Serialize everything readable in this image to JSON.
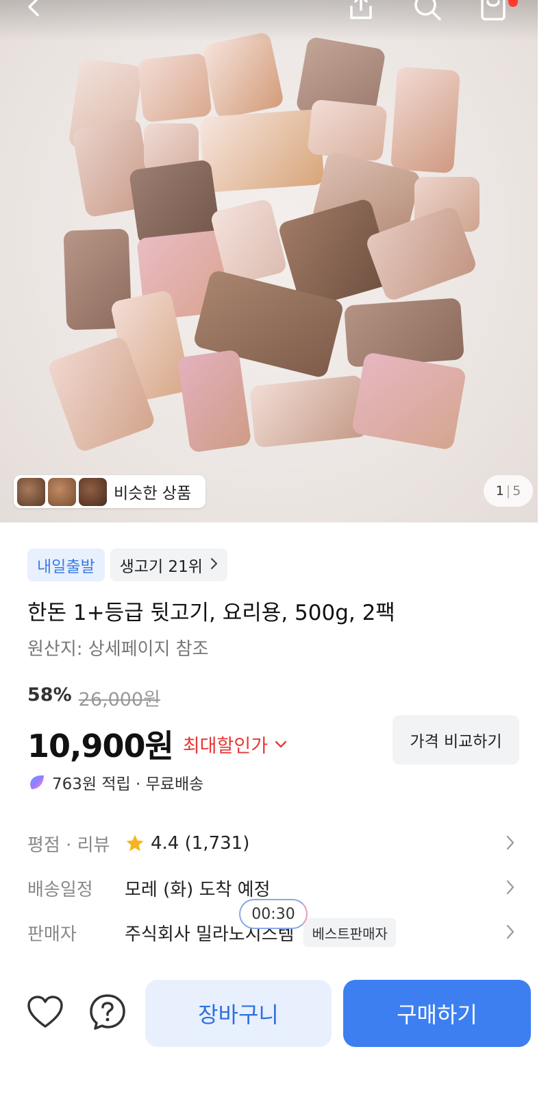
{
  "header": {
    "back_icon": "chevron-left-icon",
    "share_icon": "share-icon",
    "search_icon": "search-icon",
    "cart_icon": "cart-icon"
  },
  "gallery": {
    "similar_label": "비슷한 상품",
    "page_current": "1",
    "page_separator": "|",
    "page_total": "5"
  },
  "badges": {
    "delivery": "내일출발",
    "ranking": "생고기 21위"
  },
  "product": {
    "title": "한돈 1+등급 뒷고기, 요리용, 500g, 2팩",
    "origin": "원산지: 상세페이지 참조"
  },
  "pricing": {
    "discount_rate": "58%",
    "original_price": "26,000원",
    "price": "10,900원",
    "max_discount_label": "최대할인가",
    "compare_button": "가격 비교하기",
    "points_text": "763원 적립 · 무료배송"
  },
  "specs": {
    "rating_label": "평점 · 리뷰",
    "rating_value": "4.4 (1,731)",
    "delivery_label": "배송일정",
    "delivery_value": "모레 (화) 도착 예정",
    "seller_label": "판매자",
    "seller_value": "주식회사 밀라노시스템",
    "seller_badge": "베스트판매자"
  },
  "timer": "00:30",
  "bottom": {
    "cart_button": "장바구니",
    "buy_button": "구매하기"
  },
  "colors": {
    "accent_blue": "#3d7ff0",
    "discount_red": "#e53935",
    "star_yellow": "#f5b51f"
  }
}
